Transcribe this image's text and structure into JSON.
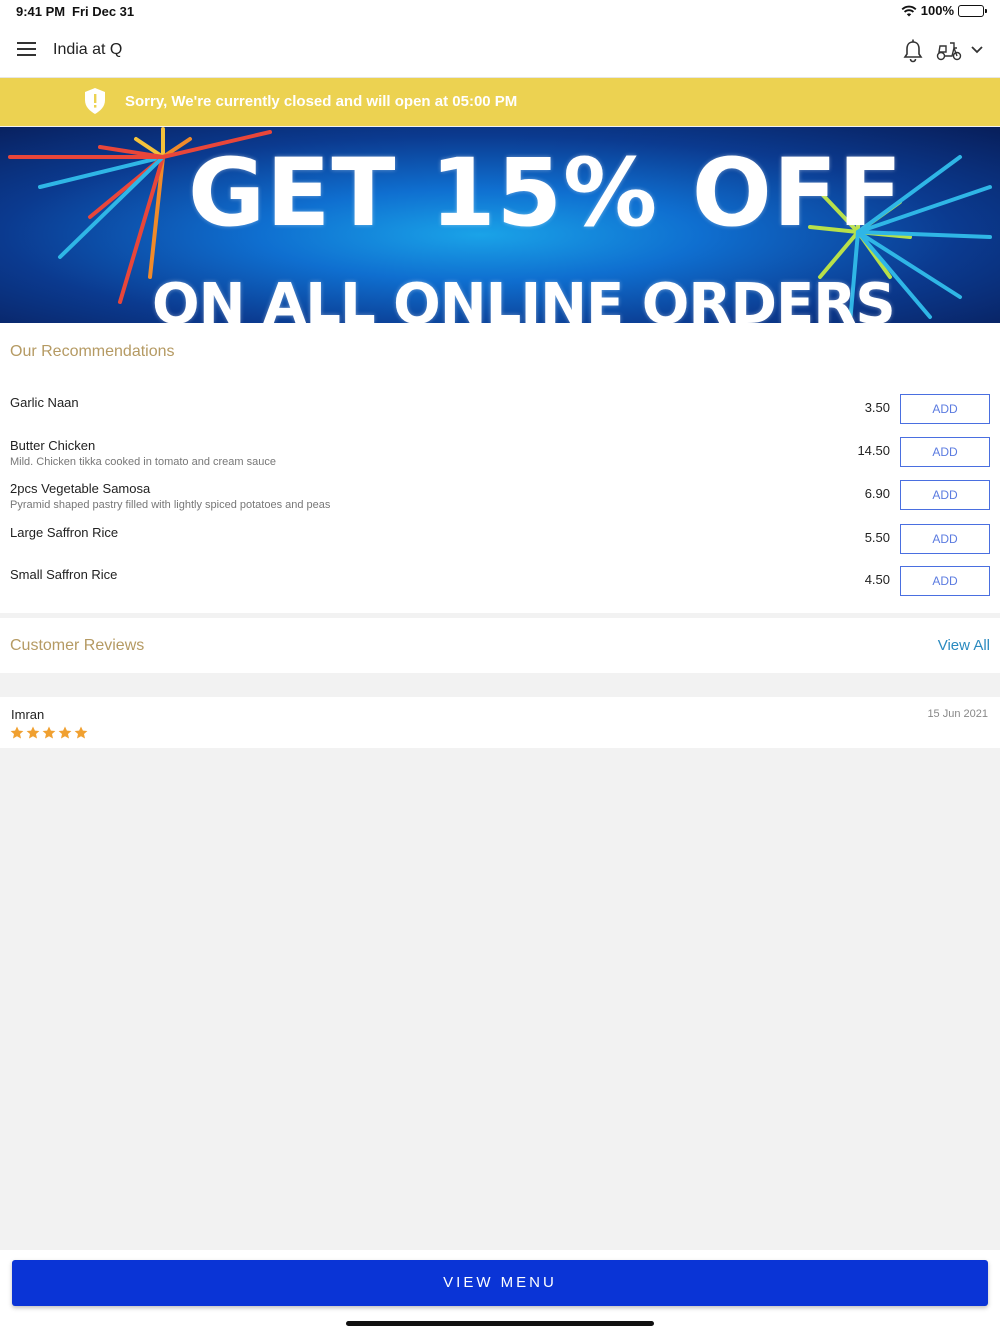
{
  "status_bar": {
    "time": "9:41 PM",
    "date": "Fri Dec 31",
    "battery": "100%"
  },
  "header": {
    "title": "India at Q",
    "icons": [
      "menu-icon",
      "bell-icon",
      "scooter-icon",
      "chevron-down-icon"
    ]
  },
  "closed_banner": {
    "text": "Sorry, We're currently closed and will open at 05:00 PM",
    "color": "#ecd251",
    "icon": "shield-icon"
  },
  "promo": {
    "headline": "GET 15% OFF",
    "subline": "ON ALL ONLINE ORDERS"
  },
  "recommendations": {
    "title": "Our Recommendations",
    "add_label": "ADD",
    "items": [
      {
        "name": "Garlic Naan",
        "description": "",
        "price": "3.50"
      },
      {
        "name": "Butter Chicken",
        "description": "Mild. Chicken tikka cooked in tomato and cream sauce",
        "price": "14.50"
      },
      {
        "name": "2pcs Vegetable Samosa",
        "description": "Pyramid shaped pastry filled with lightly spiced potatoes and peas",
        "price": "6.90"
      },
      {
        "name": "Large Saffron Rice",
        "description": "",
        "price": "5.50"
      },
      {
        "name": "Small Saffron Rice",
        "description": "",
        "price": "4.50"
      }
    ]
  },
  "reviews": {
    "title": "Customer Reviews",
    "view_all": "View All",
    "items": [
      {
        "name": "Imran",
        "date": "15 Jun 2021",
        "rating": 5
      }
    ]
  },
  "footer": {
    "button": "VIEW MENU",
    "color": "#0a34d6"
  },
  "colors": {
    "accent_gold": "#b59a63",
    "link": "#2a8abf",
    "star": "#f0a030"
  }
}
